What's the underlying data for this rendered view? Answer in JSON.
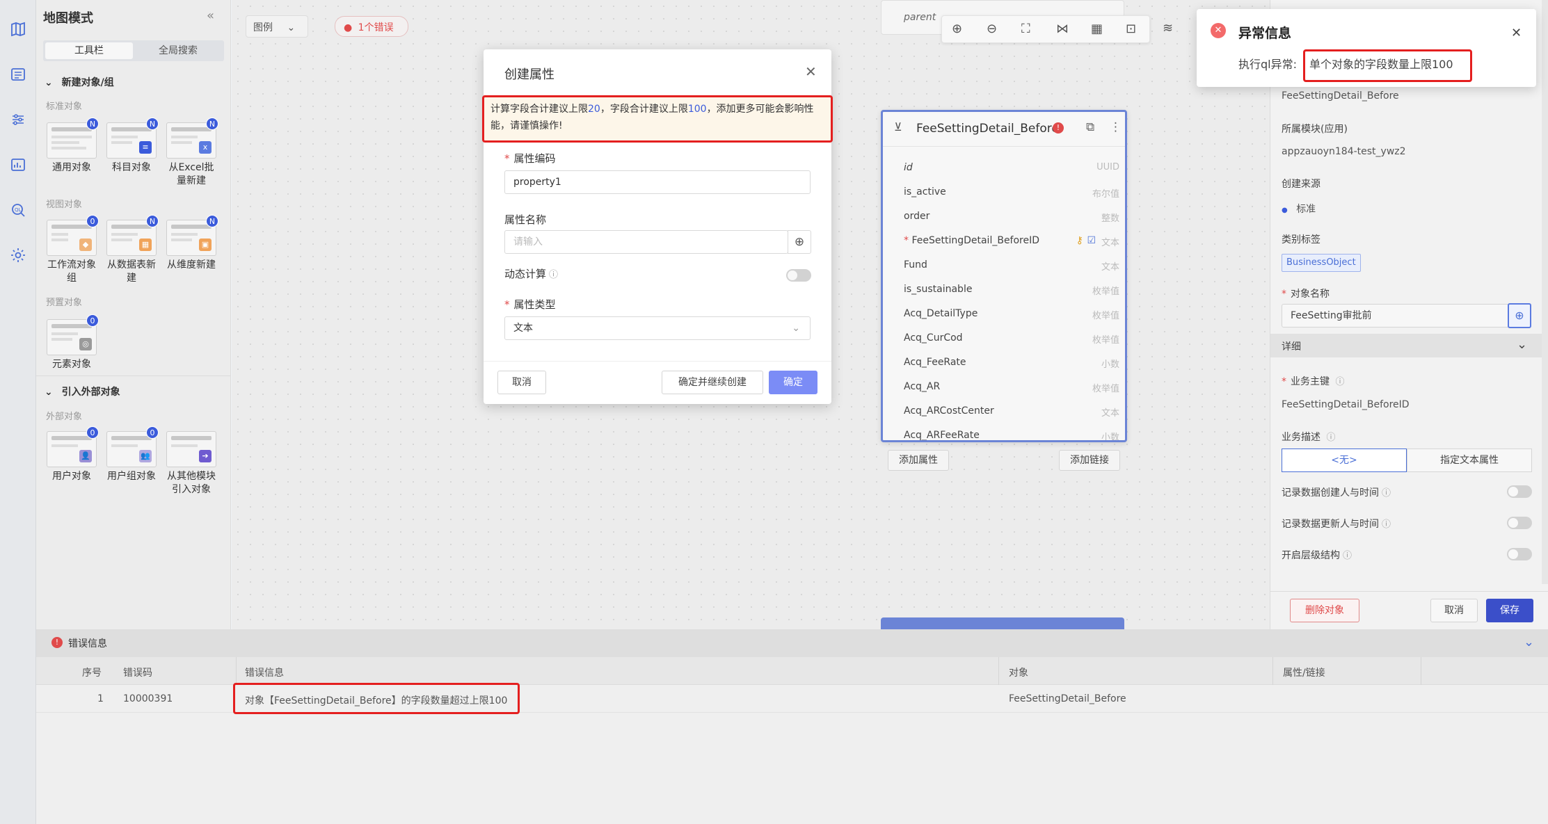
{
  "rail": {
    "icons": [
      "map-icon",
      "list-icon",
      "sliders-icon",
      "chart-icon",
      "query-icon",
      "gear-icon"
    ]
  },
  "left_panel": {
    "title": "地图模式",
    "tabs": [
      "工具栏",
      "全局搜索"
    ],
    "section_new": "新建对象/组",
    "std_objects_label": "标准对象",
    "std_tiles": [
      {
        "label": "通用对象",
        "badge": "N"
      },
      {
        "label": "科目对象",
        "badge": "N"
      },
      {
        "label": "从Excel批量新建",
        "badge": "N"
      }
    ],
    "view_objects_label": "视图对象",
    "view_tiles": [
      {
        "label": "工作流对象组",
        "badge": "0"
      },
      {
        "label": "从数据表新建",
        "badge": "N"
      },
      {
        "label": "从维度新建",
        "badge": "N"
      }
    ],
    "preset_label": "预置对象",
    "preset_tiles": [
      {
        "label": "元素对象",
        "badge": "0"
      }
    ],
    "section_import": "引入外部对象",
    "external_label": "外部对象",
    "external_tiles": [
      {
        "label": "用户对象",
        "badge": "0"
      },
      {
        "label": "用户组对象",
        "badge": "0"
      },
      {
        "label": "从其他模块引入对象",
        "badge": ""
      }
    ]
  },
  "canvas": {
    "legend_label": "图例",
    "error_pill": "1个错误",
    "parent_label": "parent",
    "toolbar_icons": [
      "zoom-in-icon",
      "zoom-out-icon",
      "fit-screen-icon",
      "share-icon",
      "grid-icon",
      "focus-icon",
      "layers-icon"
    ]
  },
  "object_card": {
    "title": "FeeSettingDetail_Before",
    "fields": [
      {
        "name": "id",
        "type": "UUID",
        "required": false,
        "italic": true
      },
      {
        "name": "is_active",
        "type": "布尔值",
        "required": false,
        "italic": false
      },
      {
        "name": "order",
        "type": "整数",
        "required": false,
        "italic": false
      },
      {
        "name": "FeeSettingDetail_BeforeID",
        "type": "文本",
        "required": true,
        "italic": false
      },
      {
        "name": "Fund",
        "type": "文本",
        "required": false,
        "italic": false
      },
      {
        "name": "is_sustainable",
        "type": "枚举值",
        "required": false,
        "italic": false
      },
      {
        "name": "Acq_DetailType",
        "type": "枚举值",
        "required": false,
        "italic": false
      },
      {
        "name": "Acq_CurCod",
        "type": "枚举值",
        "required": false,
        "italic": false
      },
      {
        "name": "Acq_FeeRate",
        "type": "小数",
        "required": false,
        "italic": false
      },
      {
        "name": "Acq_AR",
        "type": "枚举值",
        "required": false,
        "italic": false
      },
      {
        "name": "Acq_ARCostCenter",
        "type": "文本",
        "required": false,
        "italic": false
      },
      {
        "name": "Acq_ARFeeRate",
        "type": "小数",
        "required": false,
        "italic": false
      }
    ],
    "add_attr_label": "添加属性",
    "add_link_label": "添加链接"
  },
  "dialog": {
    "title": "创建属性",
    "warning_prefix": "计算字段合计建议上限",
    "warning_num1": "20",
    "warning_mid": "，字段合计建议上限",
    "warning_num2": "100",
    "warning_suffix": "，添加更多可能会影响性能，请谨慎操作!",
    "code_label": "属性编码",
    "code_value": "property1",
    "name_label": "属性名称",
    "name_placeholder": "请输入",
    "dynamic_label": "动态计算",
    "type_label": "属性类型",
    "type_value": "文本",
    "cancel_label": "取消",
    "confirm_continue_label": "确定并继续创建",
    "confirm_label": "确定"
  },
  "toast": {
    "title": "异常信息",
    "message_prefix": "执行ql异常:",
    "message_highlight": "单个对象的字段数量上限100"
  },
  "right_panel": {
    "code_value": "FeeSettingDetail_Before",
    "module_label": "所属模块(应用)",
    "module_value": "appzauoyn184-test_ywz2",
    "source_label": "创建来源",
    "source_value": "标准",
    "tag_label": "类别标签",
    "tag_value": "BusinessObject",
    "objname_label": "对象名称",
    "objname_value": "FeeSetting审批前",
    "detail_label": "详细",
    "bizkey_label": "业务主键",
    "bizkey_value": "FeeSettingDetail_BeforeID",
    "bizdesc_label": "业务描述",
    "bizdesc_none": "<无>",
    "bizdesc_text": "指定文本属性",
    "toggle1": "记录数据创建人与时间",
    "toggle2": "记录数据更新人与时间",
    "toggle3": "开启层级结构",
    "delete_label": "删除对象",
    "cancel_label": "取消",
    "save_label": "保存"
  },
  "error_panel": {
    "title": "错误信息",
    "headers": [
      "序号",
      "错误码",
      "错误信息",
      "对象",
      "属性/链接"
    ],
    "rows": [
      {
        "index": "1",
        "code": "10000391",
        "message": "对象【FeeSettingDetail_Before】的字段数量超过上限100",
        "object": "FeeSettingDetail_Before",
        "attr": ""
      }
    ]
  },
  "colors": {
    "accent": "#3b5bdb",
    "error": "#e41f1f",
    "primary_btn": "#7b8cf6"
  }
}
